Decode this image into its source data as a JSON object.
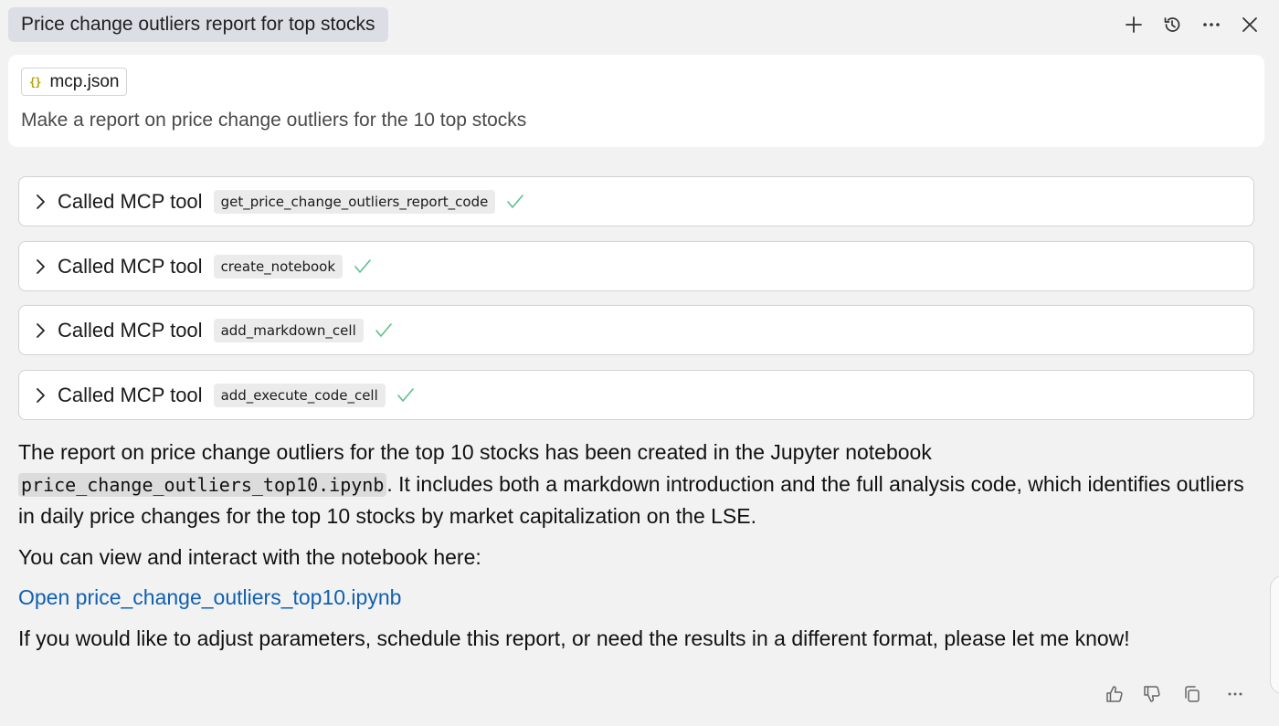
{
  "header": {
    "title": "Price change outliers report for top stocks",
    "icons": [
      "plus-icon",
      "history-icon",
      "more-icon",
      "close-icon"
    ]
  },
  "prompt": {
    "attachment": "mcp.json",
    "text": "Make a report on price change outliers for the 10 top stocks"
  },
  "tool_calls": [
    {
      "label": "Called MCP tool",
      "tool": "get_price_change_outliers_report_code"
    },
    {
      "label": "Called MCP tool",
      "tool": "create_notebook"
    },
    {
      "label": "Called MCP tool",
      "tool": "add_markdown_cell"
    },
    {
      "label": "Called MCP tool",
      "tool": "add_execute_code_cell"
    }
  ],
  "answer": {
    "p1_before": "The report on price change outliers for the top 10 stocks has been created in the Jupyter notebook ",
    "p1_code": "price_change_outliers_top10.ipynb",
    "p1_after": ". It includes both a markdown introduction and the full analysis code, which identifies outliers in daily price changes for the top 10 stocks by market capitalization on the LSE.",
    "p2": "You can view and interact with the notebook here:",
    "link": "Open price_change_outliers_top10.ipynb",
    "p3": "If you would like to adjust parameters, schedule this report, or need the results in a different format, please let me know!"
  },
  "footer_icons": [
    "thumbs-up-icon",
    "thumbs-down-icon",
    "copy-icon",
    "more-icon"
  ],
  "colors": {
    "background": "#f2f2f2",
    "title_chip": "#dcdee6",
    "check": "#5cc08a",
    "link": "#1060b0"
  }
}
